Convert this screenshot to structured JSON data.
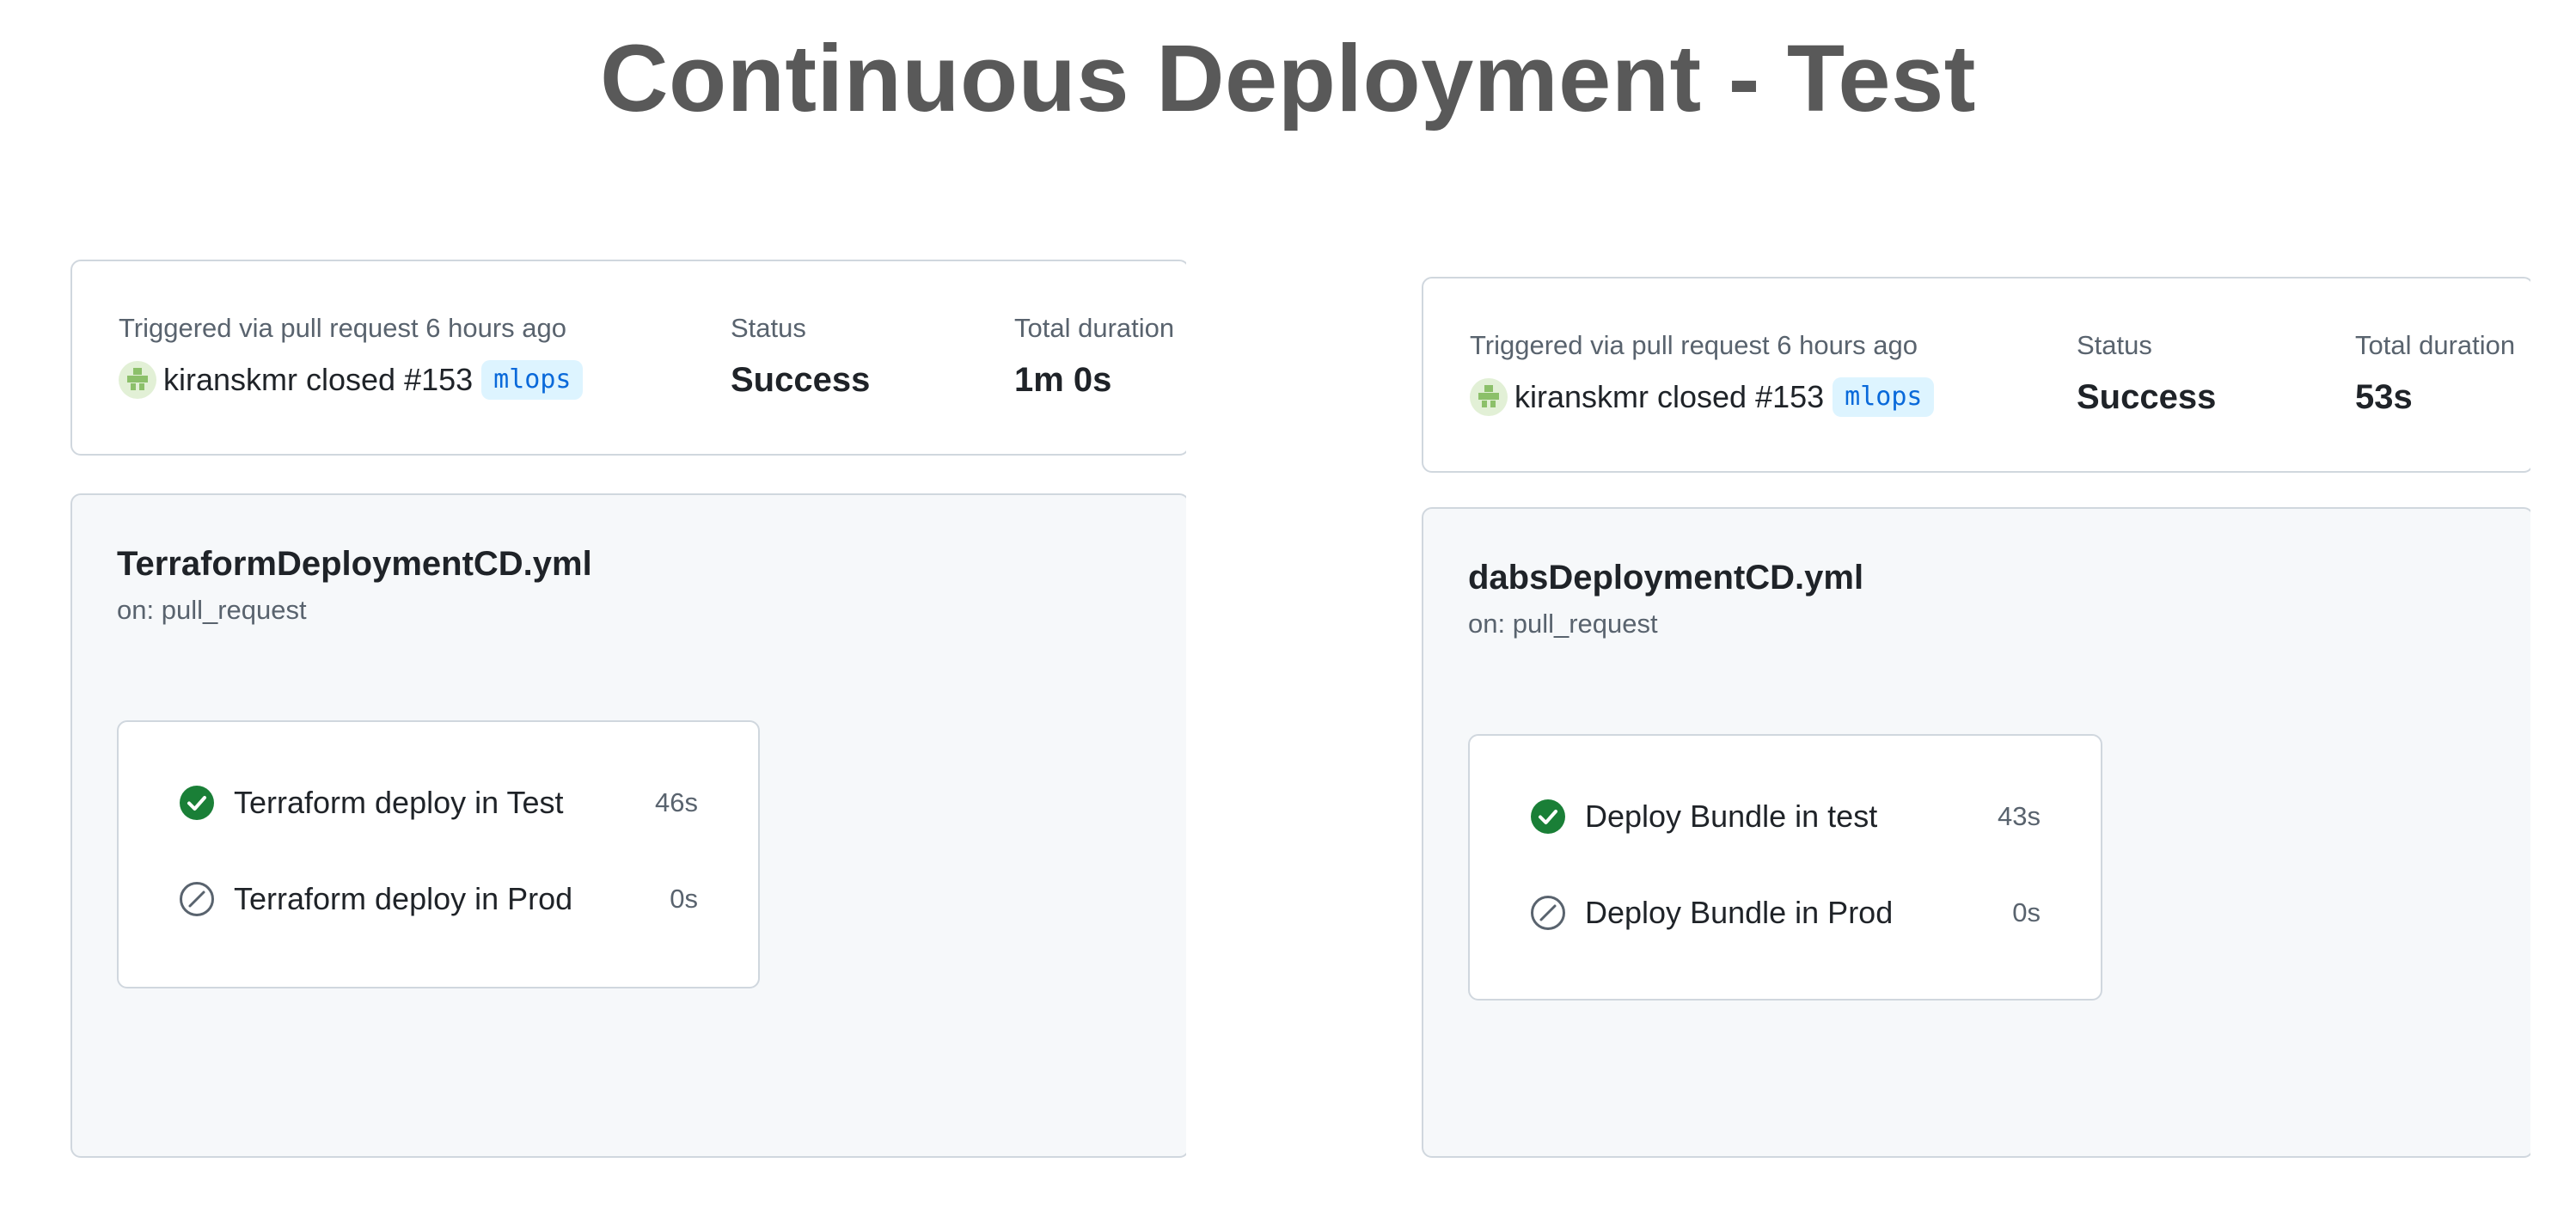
{
  "page": {
    "title": "Continuous Deployment - Test"
  },
  "runs": [
    {
      "summary": {
        "triggered_label": "Triggered via pull request 6 hours ago",
        "actor": "kiranskmr closed #153",
        "branch": "mlops",
        "status_label": "Status",
        "status_value": "Success",
        "duration_label": "Total duration",
        "duration_value": "1m 0s"
      },
      "workflow": {
        "name": "TerraformDeploymentCD.yml",
        "trigger": "on: pull_request",
        "jobs": [
          {
            "name": "Terraform deploy in Test",
            "duration": "46s",
            "state": "success",
            "icon": "check-circle-icon"
          },
          {
            "name": "Terraform deploy in Prod",
            "duration": "0s",
            "state": "skipped",
            "icon": "skipped-icon"
          }
        ]
      }
    },
    {
      "summary": {
        "triggered_label": "Triggered via pull request 6 hours ago",
        "actor": "kiranskmr closed #153",
        "branch": "mlops",
        "status_label": "Status",
        "status_value": "Success",
        "duration_label": "Total duration",
        "duration_value": "53s"
      },
      "workflow": {
        "name": "dabsDeploymentCD.yml",
        "trigger": "on: pull_request",
        "jobs": [
          {
            "name": "Deploy Bundle in test",
            "duration": "43s",
            "state": "success",
            "icon": "check-circle-icon"
          },
          {
            "name": "Deploy Bundle in Prod",
            "duration": "0s",
            "state": "skipped",
            "icon": "skipped-icon"
          }
        ]
      }
    }
  ],
  "colors": {
    "success": "#1a7f37",
    "muted": "#59636e",
    "accent": "#0969da",
    "border": "#d0d7de"
  }
}
